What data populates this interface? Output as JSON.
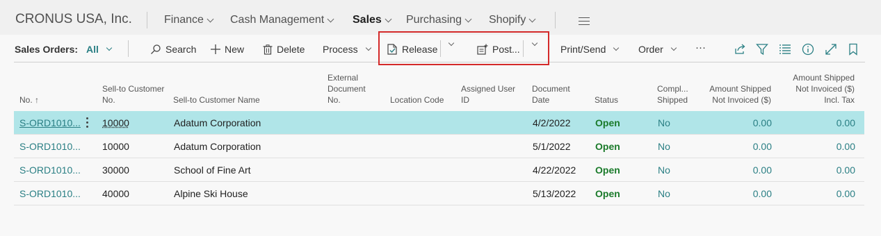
{
  "header": {
    "company": "CRONUS USA, Inc.",
    "nav": [
      "Finance",
      "Cash Management",
      "Sales",
      "Purchasing",
      "Shopify"
    ],
    "active_nav": "Sales"
  },
  "actions": {
    "page_label": "Sales Orders:",
    "filter": "All",
    "search": "Search",
    "new": "New",
    "delete": "Delete",
    "process": "Process",
    "release": "Release",
    "post": "Post...",
    "print_send": "Print/Send",
    "order": "Order",
    "more": "···"
  },
  "table": {
    "columns": {
      "no": "No. ↑",
      "sell_to_no": "Sell-to Customer No.",
      "sell_to_name": "Sell-to Customer Name",
      "ext_doc": "External Document No.",
      "location": "Location Code",
      "assigned": "Assigned User ID",
      "doc_date": "Document Date",
      "status": "Status",
      "compl": "Compl... Shipped",
      "amt_shipped": "Amount Shipped Not Invoiced ($)",
      "amt_shipped_tax": "Amount Shipped Not Invoiced ($) Incl. Tax"
    },
    "rows": [
      {
        "no": "S-ORD1010...",
        "cust_no": "10000",
        "cust_name": "Adatum Corporation",
        "doc_date": "4/2/2022",
        "status": "Open",
        "compl": "No",
        "amt": "0.00",
        "amt_tax": "0.00"
      },
      {
        "no": "S-ORD1010...",
        "cust_no": "10000",
        "cust_name": "Adatum Corporation",
        "doc_date": "5/1/2022",
        "status": "Open",
        "compl": "No",
        "amt": "0.00",
        "amt_tax": "0.00"
      },
      {
        "no": "S-ORD1010...",
        "cust_no": "30000",
        "cust_name": "School of Fine Art",
        "doc_date": "4/22/2022",
        "status": "Open",
        "compl": "No",
        "amt": "0.00",
        "amt_tax": "0.00"
      },
      {
        "no": "S-ORD1010...",
        "cust_no": "40000",
        "cust_name": "Alpine Ski House",
        "doc_date": "5/13/2022",
        "status": "Open",
        "compl": "No",
        "amt": "0.00",
        "amt_tax": "0.00"
      }
    ]
  },
  "colors": {
    "accent": "#2a7f84",
    "selected_row": "#b0e5e8",
    "status_open": "#1a7a2a",
    "highlight": "#d42a2a"
  }
}
